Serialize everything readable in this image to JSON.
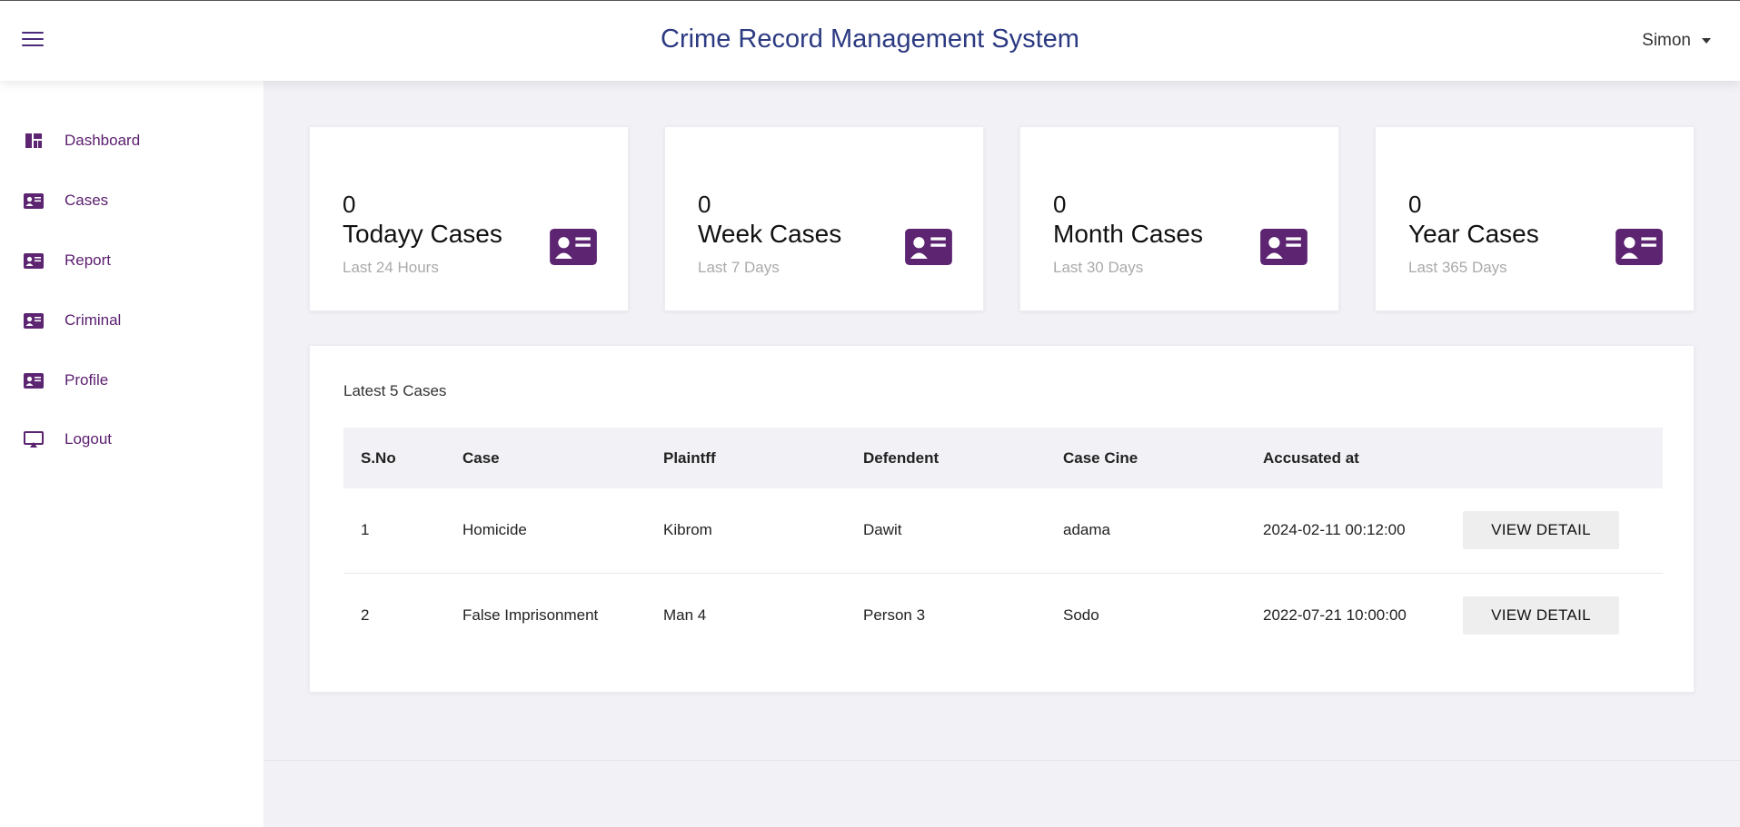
{
  "header": {
    "title": "Crime Record Management System",
    "user_name": "Simon",
    "menu_icon": "hamburger-icon"
  },
  "sidebar": {
    "items": [
      {
        "label": "Dashboard",
        "icon": "dashboard-icon"
      },
      {
        "label": "Cases",
        "icon": "id-card-icon"
      },
      {
        "label": "Report",
        "icon": "id-card-icon"
      },
      {
        "label": "Criminal",
        "icon": "id-card-icon"
      },
      {
        "label": "Profile",
        "icon": "id-card-icon"
      },
      {
        "label": "Logout",
        "icon": "monitor-icon"
      }
    ]
  },
  "stats": [
    {
      "count": "0",
      "title": "Todayy Cases",
      "subtitle": "Last 24 Hours",
      "icon": "id-card-icon"
    },
    {
      "count": "0",
      "title": "Week Cases",
      "subtitle": "Last 7 Days",
      "icon": "id-card-icon"
    },
    {
      "count": "0",
      "title": "Month Cases",
      "subtitle": "Last 30 Days",
      "icon": "id-card-icon"
    },
    {
      "count": "0",
      "title": "Year Cases",
      "subtitle": "Last 365 Days",
      "icon": "id-card-icon"
    }
  ],
  "latest": {
    "caption": "Latest 5 Cases",
    "columns": [
      "S.No",
      "Case",
      "Plaintff",
      "Defendent",
      "Case Cine",
      "Accusated at",
      ""
    ],
    "rows": [
      {
        "sno": "1",
        "case": "Homicide",
        "plaintiff": "Kibrom",
        "defendant": "Dawit",
        "place": "adama",
        "accused_at": "2024-02-11 00:12:00",
        "action": "VIEW DETAIL"
      },
      {
        "sno": "2",
        "case": "False Imprisonment",
        "plaintiff": "Man 4",
        "defendant": "Person 3",
        "place": "Sodo",
        "accused_at": "2022-07-21 10:00:00",
        "action": "VIEW DETAIL"
      }
    ]
  },
  "colors": {
    "accent": "#5c2471",
    "title": "#2c3a82",
    "background": "#f1f1f6"
  }
}
